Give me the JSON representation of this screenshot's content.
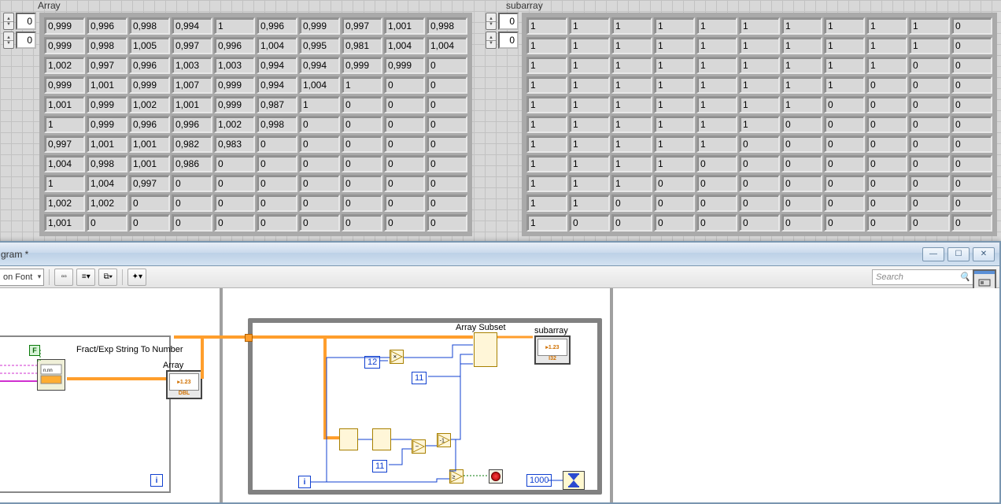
{
  "front": {
    "array_label": "Array",
    "subarray_label": "subarray",
    "index_value": "0",
    "array_data": [
      [
        "0,999",
        "0,996",
        "0,998",
        "0,994",
        "1",
        "0,996",
        "0,999",
        "0,997",
        "1,001",
        "0,998"
      ],
      [
        "0,999",
        "0,998",
        "1,005",
        "0,997",
        "0,996",
        "1,004",
        "0,995",
        "0,981",
        "1,004",
        "1,004"
      ],
      [
        "1,002",
        "0,997",
        "0,996",
        "1,003",
        "1,003",
        "0,994",
        "0,994",
        "0,999",
        "0,999",
        "0"
      ],
      [
        "0,999",
        "1,001",
        "0,999",
        "1,007",
        "0,999",
        "0,994",
        "1,004",
        "1",
        "0",
        "0"
      ],
      [
        "1,001",
        "0,999",
        "1,002",
        "1,001",
        "0,999",
        "0,987",
        "1",
        "0",
        "0",
        "0"
      ],
      [
        "1",
        "0,999",
        "0,996",
        "0,996",
        "1,002",
        "0,998",
        "0",
        "0",
        "0",
        "0"
      ],
      [
        "0,997",
        "1,001",
        "1,001",
        "0,982",
        "0,983",
        "0",
        "0",
        "0",
        "0",
        "0"
      ],
      [
        "1,004",
        "0,998",
        "1,001",
        "0,986",
        "0",
        "0",
        "0",
        "0",
        "0",
        "0"
      ],
      [
        "1",
        "1,004",
        "0,997",
        "0",
        "0",
        "0",
        "0",
        "0",
        "0",
        "0"
      ],
      [
        "1,002",
        "1,002",
        "0",
        "0",
        "0",
        "0",
        "0",
        "0",
        "0",
        "0"
      ],
      [
        "1,001",
        "0",
        "0",
        "0",
        "0",
        "0",
        "0",
        "0",
        "0",
        "0"
      ]
    ],
    "subarray_data": [
      [
        "1",
        "1",
        "1",
        "1",
        "1",
        "1",
        "1",
        "1",
        "1",
        "1",
        "0"
      ],
      [
        "1",
        "1",
        "1",
        "1",
        "1",
        "1",
        "1",
        "1",
        "1",
        "1",
        "0"
      ],
      [
        "1",
        "1",
        "1",
        "1",
        "1",
        "1",
        "1",
        "1",
        "1",
        "0",
        "0"
      ],
      [
        "1",
        "1",
        "1",
        "1",
        "1",
        "1",
        "1",
        "1",
        "0",
        "0",
        "0"
      ],
      [
        "1",
        "1",
        "1",
        "1",
        "1",
        "1",
        "1",
        "0",
        "0",
        "0",
        "0"
      ],
      [
        "1",
        "1",
        "1",
        "1",
        "1",
        "1",
        "0",
        "0",
        "0",
        "0",
        "0"
      ],
      [
        "1",
        "1",
        "1",
        "1",
        "1",
        "0",
        "0",
        "0",
        "0",
        "0",
        "0"
      ],
      [
        "1",
        "1",
        "1",
        "1",
        "0",
        "0",
        "0",
        "0",
        "0",
        "0",
        "0"
      ],
      [
        "1",
        "1",
        "1",
        "0",
        "0",
        "0",
        "0",
        "0",
        "0",
        "0",
        "0"
      ],
      [
        "1",
        "1",
        "0",
        "0",
        "0",
        "0",
        "0",
        "0",
        "0",
        "0",
        "0"
      ],
      [
        "1",
        "0",
        "0",
        "0",
        "0",
        "0",
        "0",
        "0",
        "0",
        "0",
        "0"
      ]
    ]
  },
  "bd": {
    "window_title": "gram *",
    "font_label": "on Font",
    "search_placeholder": "Search",
    "help": "?",
    "labels": {
      "fract": "Fract/Exp String To Number",
      "array": "Array",
      "subset": "Array Subset",
      "subarray": "subarray"
    },
    "consts": {
      "c12": "12",
      "c11a": "11",
      "c11b": "11",
      "c1000": "1000",
      "F": "F",
      "i": "i",
      "i2": "i"
    }
  },
  "winbtns": {
    "min": "—",
    "max": "☐",
    "close": "✕"
  }
}
